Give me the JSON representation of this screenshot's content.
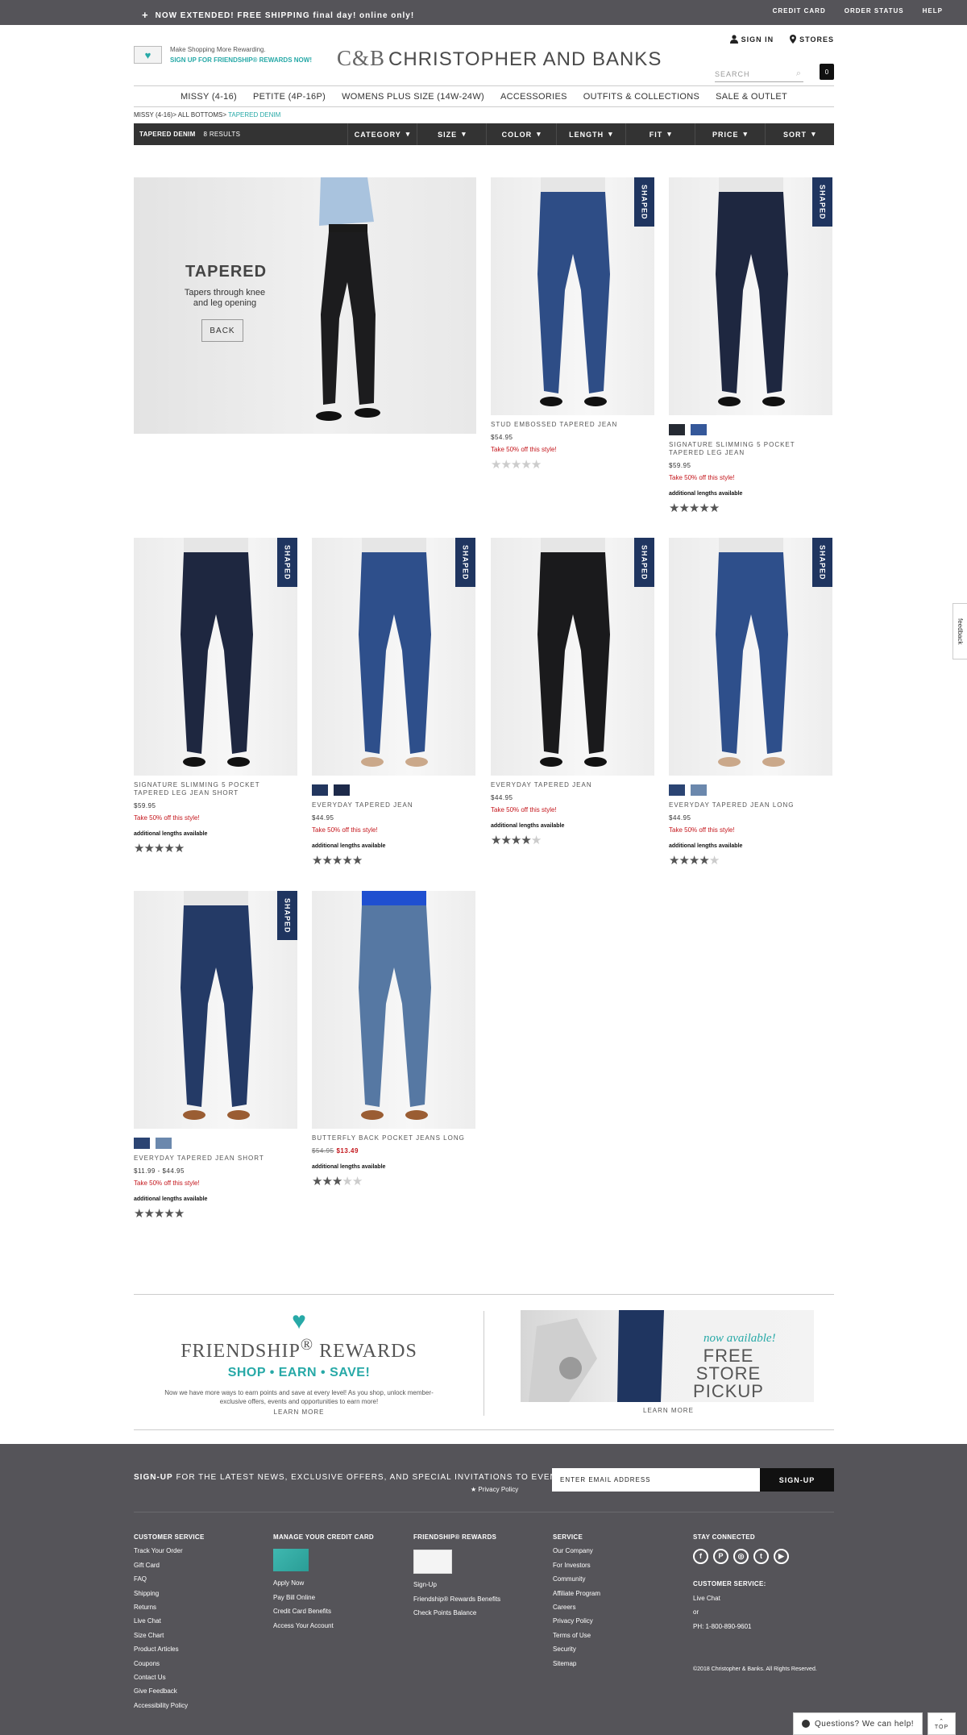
{
  "topbar": {
    "promo": "NOW EXTENDED! FREE SHIPPING final day! online only!",
    "links": [
      "CREDIT CARD",
      "ORDER STATUS",
      "HELP"
    ]
  },
  "header": {
    "rewards_line1": "Make Shopping More Rewarding.",
    "rewards_line2": "SIGN UP FOR FRIENDSHIP® REWARDS NOW!",
    "logo_mark": "C&B",
    "logo_text": "CHRISTOPHER AND BANKS",
    "sign_in": "SIGN IN",
    "stores": "STORES",
    "search_placeholder": "SEARCH",
    "bag_count": "0"
  },
  "nav": [
    "MISSY (4-16)",
    "PETITE (4P-16P)",
    "WOMENS PLUS SIZE (14W-24W)",
    "ACCESSORIES",
    "OUTFITS & COLLECTIONS",
    "SALE & OUTLET"
  ],
  "breadcrumb": {
    "a": "MISSY (4-16)>",
    "b": "ALL BOTTOMS>",
    "current": "TAPERED DENIM"
  },
  "filters": {
    "category": "TAPERED DENIM",
    "results": "8 RESULTS",
    "items": [
      "CATEGORY",
      "SIZE",
      "COLOR",
      "LENGTH",
      "FIT",
      "PRICE",
      "SORT"
    ]
  },
  "hero": {
    "title": "TAPERED",
    "subtitle": "Tapers through knee and leg opening",
    "button": "BACK"
  },
  "colors": {
    "accent": "#27a9a7",
    "sale": "#c4161c",
    "dark": "#333333",
    "footer": "#555459",
    "badge": "#1f3560"
  },
  "products": [
    {
      "name": "STUD EMBOSSED TAPERED JEAN",
      "price": "$54.95",
      "promo": "Take 50% off this style!",
      "badge": "SHAPED",
      "rating": 0,
      "swatches": [],
      "lengths": "",
      "wash": "#2e4d86"
    },
    {
      "name": "SIGNATURE SLIMMING 5 POCKET TAPERED LEG JEAN",
      "price": "$59.95",
      "promo": "Take 50% off this style!",
      "badge": "SHAPED",
      "rating": 4.5,
      "swatches": [
        "#252a33",
        "#35589a"
      ],
      "lengths": "additional lengths available",
      "wash": "#1e2740"
    },
    {
      "name": "SIGNATURE SLIMMING 5 POCKET TAPERED LEG JEAN SHORT",
      "price": "$59.95",
      "promo": "Take 50% off this style!",
      "badge": "SHAPED",
      "rating": 4.5,
      "swatches": [],
      "lengths": "additional lengths available",
      "wash": "#1e2740"
    },
    {
      "name": "EVERYDAY TAPERED JEAN",
      "price": "$44.95",
      "promo": "Take 50% off this style!",
      "badge": "SHAPED",
      "rating": 4.5,
      "swatches": [
        "#22365e",
        "#1d2a4a"
      ],
      "lengths": "additional lengths available",
      "wash": "#2e4f8b"
    },
    {
      "name": "EVERYDAY TAPERED JEAN",
      "price": "$44.95",
      "promo": "Take 50% off this style!",
      "badge": "SHAPED",
      "rating": 4,
      "swatches": [],
      "lengths": "additional lengths available",
      "wash": "#1a1a1c"
    },
    {
      "name": "EVERYDAY TAPERED JEAN LONG",
      "price": "$44.95",
      "promo": "Take 50% off this style!",
      "badge": "SHAPED",
      "rating": 4,
      "swatches": [
        "#2b4473",
        "#6b88ad"
      ],
      "lengths": "additional lengths available",
      "wash": "#2e4f8b"
    },
    {
      "name": "EVERYDAY TAPERED JEAN SHORT",
      "price": "$11.99 - $44.95",
      "promo": "Take 50% off this style!",
      "badge": "SHAPED",
      "rating": 4.5,
      "swatches": [
        "#2b4473",
        "#6b88ad"
      ],
      "lengths": "additional lengths available",
      "wash": "#243a66"
    },
    {
      "name": "BUTTERFLY BACK POCKET JEANS LONG",
      "price_old": "$54.95",
      "price_new": "$13.49",
      "promo": "",
      "badge": "",
      "rating": 3,
      "swatches": [],
      "lengths": "additional lengths available",
      "wash": "#5678a3"
    }
  ],
  "friendship": {
    "title": "FRIENDSHIP",
    "reg": "®",
    "title2": "REWARDS",
    "tagline": "SHOP • EARN • SAVE!",
    "desc": "Now we have more ways to earn points and save at every level! As you shop, unlock member-exclusive offers, events and opportunities to earn more!",
    "learn_more": "LEARN MORE"
  },
  "store_pickup": {
    "now": "now available!",
    "title": "FREE STORE PICKUP",
    "learn_more": "LEARN MORE"
  },
  "footer": {
    "signup_bold": "SIGN-UP",
    "signup_rest": "FOR THE LATEST NEWS, EXCLUSIVE OFFERS, AND SPECIAL INVITATIONS TO EVENTS",
    "privacy": "Privacy Policy",
    "email_placeholder": "ENTER EMAIL ADDRESS",
    "signup_button": "SIGN-UP",
    "customer_service": {
      "heading": "CUSTOMER SERVICE",
      "links": [
        "Track Your Order",
        "Gift Card",
        "FAQ",
        "Shipping",
        "Returns",
        "Live Chat",
        "Size Chart",
        "Product Articles",
        "Coupons",
        "Contact Us",
        "Give Feedback",
        "Accessibility Policy"
      ]
    },
    "credit_card": {
      "heading": "MANAGE YOUR CREDIT CARD",
      "links": [
        "Apply Now",
        "Pay Bill Online",
        "Credit Card Benefits",
        "Access Your Account"
      ]
    },
    "rewards": {
      "heading": "FRIENDSHIP® REWARDS",
      "links": [
        "Sign-Up",
        "Friendship® Rewards Benefits",
        "Check Points Balance"
      ]
    },
    "service": {
      "heading": "SERVICE",
      "links": [
        "Our Company",
        "For Investors",
        "Community",
        "Affiliate Program",
        "Careers",
        "Privacy Policy",
        "Terms of Use",
        "Security",
        "Sitemap"
      ]
    },
    "stay": {
      "heading": "STAY CONNECTED",
      "icons": [
        "facebook-icon",
        "pinterest-icon",
        "instagram-icon",
        "twitter-icon",
        "youtube-icon"
      ],
      "cs_heading": "CUSTOMER SERVICE:",
      "live_chat": "Live Chat",
      "or": "or",
      "phone": "PH: 1-800-890-9601"
    },
    "copyright": "©2018 Christopher & Banks. All Rights Reserved."
  },
  "chat": {
    "label": "Questions? We can help!",
    "top": "TOP"
  },
  "feedback": "feedback"
}
